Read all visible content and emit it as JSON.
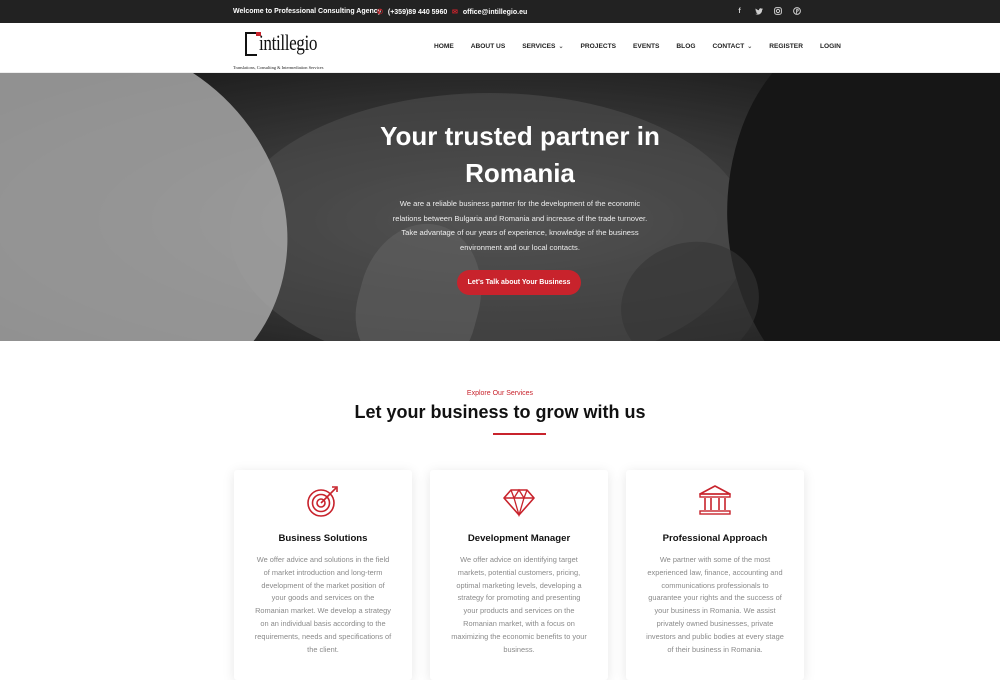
{
  "topbar": {
    "welcome": "Welcome to Professional Consulting Agency",
    "phone": "(+359)89 440 5960",
    "email": "office@intillegio.eu",
    "social_icons": [
      "facebook-icon",
      "twitter-icon",
      "instagram-icon",
      "pinterest-icon"
    ]
  },
  "logo": {
    "name": "intillegio",
    "tagline": "Translations, Consulting & Intermediation Services"
  },
  "nav": {
    "items": [
      {
        "label": "HOME"
      },
      {
        "label": "ABOUT US"
      },
      {
        "label": "SERVICES",
        "dropdown": true
      },
      {
        "label": "PROJECTS"
      },
      {
        "label": "EVENTS"
      },
      {
        "label": "BLOG"
      },
      {
        "label": "CONTACT",
        "dropdown": true
      },
      {
        "label": "REGISTER"
      },
      {
        "label": "LOGIN"
      }
    ]
  },
  "hero": {
    "title": "Your trusted partner in Romania",
    "text": "We are a reliable business partner for the development of the economic relations between Bulgaria and Romania and increase of the trade turnover. Take advantage of our years of experience, knowledge of the business environment and our local contacts.",
    "cta": "Let's Talk about Your Business"
  },
  "services": {
    "eyebrow": "Explore Our Services",
    "title": "Let your business to grow with us",
    "cards": [
      {
        "icon": "target-icon",
        "title": "Business Solutions",
        "text": "We offer advice and solutions in the field of market introduction and long-term development of the market position of your goods and services on the Romanian market. We develop a strategy on an individual basis according to the requirements, needs and specifications of the client."
      },
      {
        "icon": "diamond-icon",
        "title": "Development Manager",
        "text": "We offer advice on identifying target markets, potential customers, pricing, optimal marketing levels, developing a strategy for promoting and presenting your products and services on the Romanian market, with a focus on maximizing the economic benefits to your business."
      },
      {
        "icon": "bank-icon",
        "title": "Professional Approach",
        "text": "We partner with some of the most experienced law, finance, accounting and communications professionals to guarantee your rights and the success of your business in Romania. We assist privately owned businesses, private investors and public bodies at every stage of their business in Romania."
      }
    ]
  },
  "colors": {
    "accent": "#c8232c",
    "topbar": "#222222"
  }
}
